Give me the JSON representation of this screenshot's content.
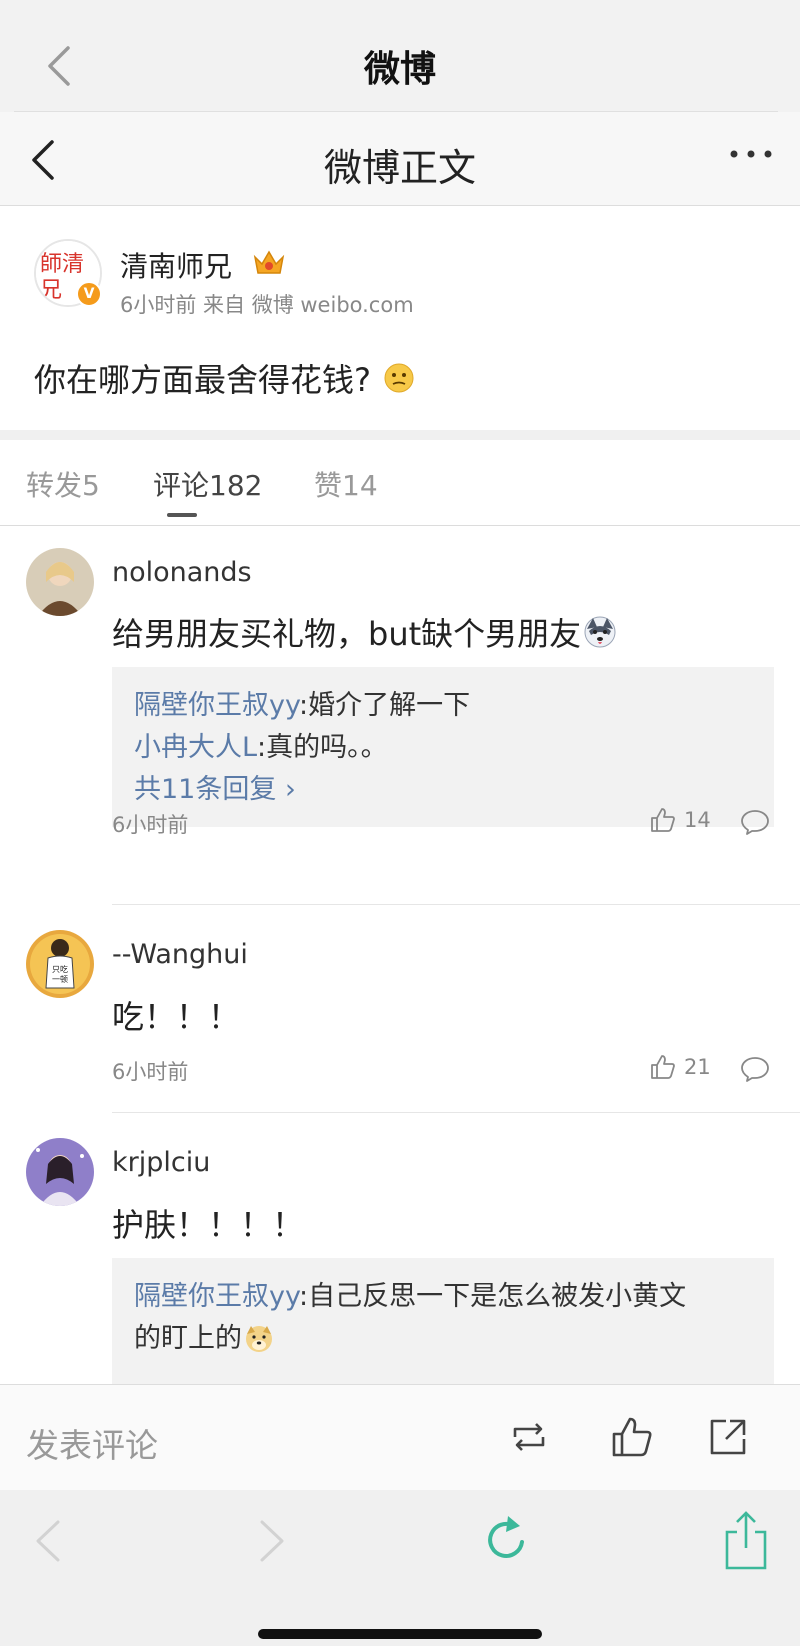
{
  "browser": {
    "title": "微博"
  },
  "nav": {
    "title": "微博正文"
  },
  "post": {
    "author": "清南师兄",
    "meta": "6小时前 来自 微博 weibo.com",
    "content": "你在哪方面最舍得花钱?",
    "avatar_text": "師清兄南"
  },
  "tabs": [
    {
      "label": "转发5"
    },
    {
      "label": "评论182"
    },
    {
      "label": "赞14"
    }
  ],
  "comments": [
    {
      "name": "nolonands",
      "text": "给男朋友买礼物，but缺个男朋友",
      "replies": [
        {
          "user": "隔壁你王叔yy",
          "text": ":婚介了解一下"
        },
        {
          "user": "小冉大人L",
          "text": ":真的吗。。"
        }
      ],
      "more": "共11条回复 ›",
      "time": "6小时前",
      "likes": "14"
    },
    {
      "name": "--Wanghui",
      "text": "吃！！！",
      "time": "6小时前",
      "likes": "21"
    },
    {
      "name": "krjplciu",
      "text": "护肤！！！！",
      "replies": [
        {
          "user": "隔壁你王叔yy",
          "text": ":自己反思一下是怎么被发小黄文"
        },
        {
          "user": "",
          "text": "的盯上的"
        }
      ]
    }
  ],
  "input": {
    "placeholder": "发表评论"
  },
  "colors": {
    "link": "#5b7ba8",
    "accent": "#f59b1b",
    "browser_green": "#3cb89a"
  }
}
